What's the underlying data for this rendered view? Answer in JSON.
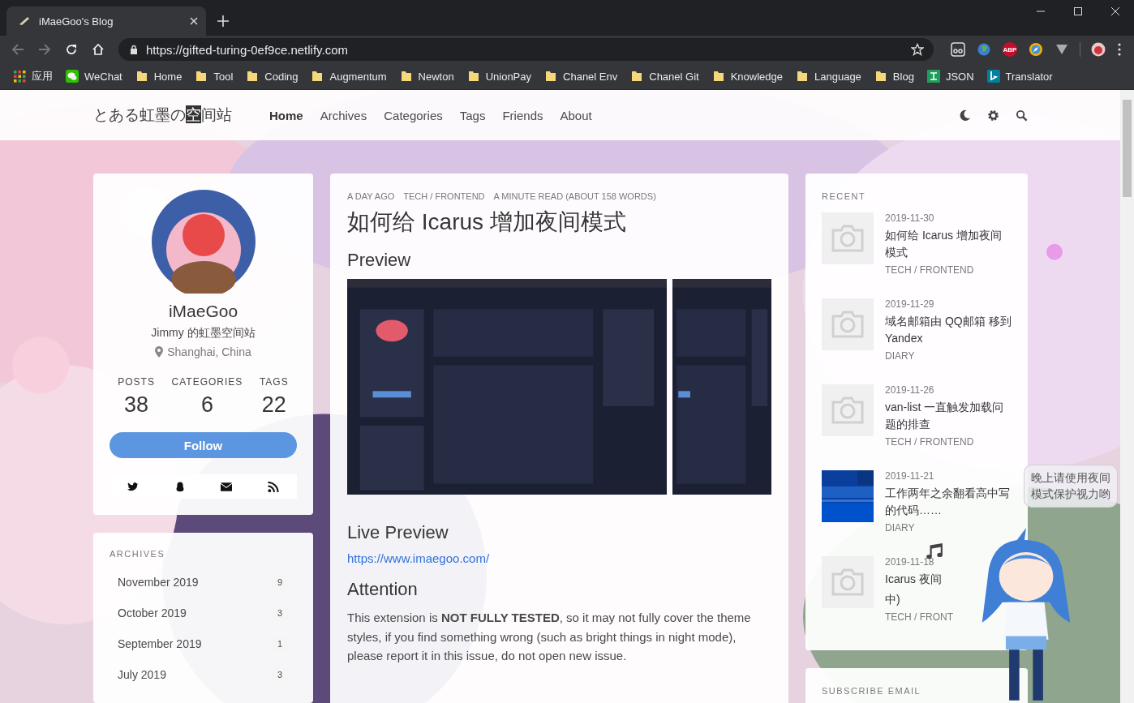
{
  "browser": {
    "tab": {
      "title": "iMaeGoo's Blog"
    },
    "address": "https://gifted-turing-0ef9ce.netlify.com",
    "abp_label": "ABP",
    "bookmarks": [
      {
        "label": "应用"
      },
      {
        "label": "WeChat"
      },
      {
        "label": "Home"
      },
      {
        "label": "Tool"
      },
      {
        "label": "Coding"
      },
      {
        "label": "Augmentum"
      },
      {
        "label": "Newton"
      },
      {
        "label": "UnionPay"
      },
      {
        "label": "Chanel Env"
      },
      {
        "label": "Chanel Git"
      },
      {
        "label": "Knowledge"
      },
      {
        "label": "Language"
      },
      {
        "label": "Blog"
      },
      {
        "label": "JSON"
      },
      {
        "label": "Translator"
      }
    ]
  },
  "navbar": {
    "logo": [
      {
        "text": "とある虹墨の",
        "inverse": false
      },
      {
        "text": "空",
        "inverse": true
      },
      {
        "text": "间站",
        "inverse": false
      }
    ],
    "items": [
      {
        "label": "Home",
        "selected": true
      },
      {
        "label": "Archives",
        "selected": false
      },
      {
        "label": "Categories",
        "selected": false
      },
      {
        "label": "Tags",
        "selected": false
      },
      {
        "label": "Friends",
        "selected": false
      },
      {
        "label": "About",
        "selected": false
      }
    ]
  },
  "profile": {
    "name": "iMaeGoo",
    "subtitle": "Jimmy 的虹墨空间站",
    "location": "Shanghai, China",
    "stats": [
      {
        "label": "POSTS",
        "value": "38"
      },
      {
        "label": "CATEGORIES",
        "value": "6"
      },
      {
        "label": "TAGS",
        "value": "22"
      }
    ],
    "follow": "Follow"
  },
  "archives": {
    "title": "ARCHIVES",
    "items": [
      {
        "label": "November 2019",
        "count": "9"
      },
      {
        "label": "October 2019",
        "count": "3"
      },
      {
        "label": "September 2019",
        "count": "1"
      },
      {
        "label": "July 2019",
        "count": "3"
      }
    ]
  },
  "post": {
    "meta": [
      "A DAY AGO",
      "TECH / FRONTEND",
      "A MINUTE READ (ABOUT 158 WORDS)"
    ],
    "title": "如何给 Icarus 增加夜间模式",
    "blocks": [
      {
        "kind": "heading",
        "text": "Preview"
      },
      {
        "kind": "images"
      },
      {
        "kind": "heading",
        "text": "Live Preview"
      },
      {
        "kind": "link",
        "text": "https://www.imaegoo.com/"
      },
      {
        "kind": "heading",
        "text": "Attention"
      },
      {
        "kind": "paragraph",
        "text": "This extension is **NOT FULLY TESTED**, so it may not fully cover the theme styles, if you find something wrong (such as bright things in night mode), please report it in this issue, do not open new issue."
      }
    ]
  },
  "recent": {
    "title": "RECENT",
    "items": [
      {
        "date": "2019-11-30",
        "title_lines": [
          "如何给 Icarus 增加夜间模式"
        ],
        "category": "TECH / FRONTEND"
      },
      {
        "date": "2019-11-29",
        "title_lines": [
          "域名邮箱由 QQ邮箱 移到 Yandex"
        ],
        "category": "DIARY"
      },
      {
        "date": "2019-11-26",
        "title_lines": [
          "van-list 一直触发加载问题的排查"
        ],
        "category": "TECH / FRONTEND"
      },
      {
        "date": "2019-11-21",
        "title_lines": [
          "工作两年之余翻看高中写的代码……"
        ],
        "category": "DIARY"
      },
      {
        "date": "2019-11-18",
        "title_lines": [
          "Icarus 夜间",
          "中)"
        ],
        "category": "TECH / FRONT"
      }
    ]
  },
  "subscribe": {
    "title": "SUBSCRIBE EMAIL"
  },
  "mascot": {
    "message": "晚上请使用夜间模式保护视力哟"
  }
}
